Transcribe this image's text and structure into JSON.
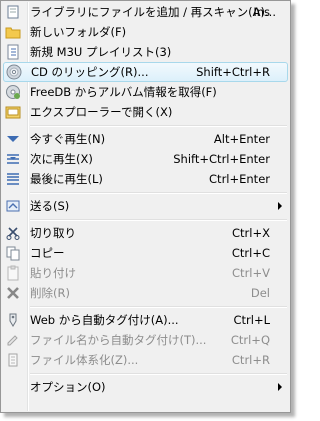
{
  "menu": {
    "items": [
      {
        "label": "ライブラリにファイルを追加 / 再スキャン(A)...",
        "shortcut": "Ins",
        "icon": "add-files-icon",
        "disabled": false
      },
      {
        "label": "新しいフォルダ(F)",
        "shortcut": "",
        "icon": "folder-icon",
        "disabled": false
      },
      {
        "label": "新規 M3U プレイリスト(3)",
        "shortcut": "",
        "icon": "playlist-icon",
        "disabled": false
      },
      {
        "label": "CD のリッピング(R)...",
        "shortcut": "Shift+Ctrl+R",
        "icon": "cd-rip-icon",
        "disabled": false,
        "highlighted": true
      },
      {
        "label": "FreeDB からアルバム情報を取得(F)",
        "shortcut": "",
        "icon": "freedb-icon",
        "disabled": false
      },
      {
        "label": "エクスプローラーで開く(X)",
        "shortcut": "",
        "icon": "explorer-icon",
        "disabled": false
      },
      {
        "label": "今すぐ再生(N)",
        "shortcut": "Alt+Enter",
        "icon": "play-now-icon",
        "disabled": false
      },
      {
        "label": "次に再生(X)",
        "shortcut": "Shift+Ctrl+Enter",
        "icon": "play-next-icon",
        "disabled": false
      },
      {
        "label": "最後に再生(L)",
        "shortcut": "Ctrl+Enter",
        "icon": "play-last-icon",
        "disabled": false
      },
      {
        "label": "送る(S)",
        "shortcut": "",
        "icon": "send-to-icon",
        "disabled": false,
        "submenu": true
      },
      {
        "label": "切り取り",
        "shortcut": "Ctrl+X",
        "icon": "cut-icon",
        "disabled": false
      },
      {
        "label": "コピー",
        "shortcut": "Ctrl+C",
        "icon": "copy-icon",
        "disabled": false
      },
      {
        "label": "貼り付け",
        "shortcut": "Ctrl+V",
        "icon": "paste-icon",
        "disabled": true
      },
      {
        "label": "削除(R)",
        "shortcut": "Del",
        "icon": "delete-icon",
        "disabled": true
      },
      {
        "label": "Web から自動タグ付け(A)...",
        "shortcut": "Ctrl+L",
        "icon": "web-autotag-icon",
        "disabled": false
      },
      {
        "label": "ファイル名から自動タグ付け(T)...",
        "shortcut": "Ctrl+Q",
        "icon": "filename-autotag-icon",
        "disabled": true
      },
      {
        "label": "ファイル体系化(Z)...",
        "shortcut": "Ctrl+R",
        "icon": "organize-files-icon",
        "disabled": true
      },
      {
        "label": "オプション(O)",
        "shortcut": "",
        "icon": "options-icon",
        "disabled": false,
        "submenu": true
      }
    ]
  },
  "colors": {
    "highlight_border": "#a8d8eb",
    "highlight_bg": "#dcf0fb",
    "disabled_text": "#8d8d8d",
    "menu_bg": "#f0f0f0"
  }
}
